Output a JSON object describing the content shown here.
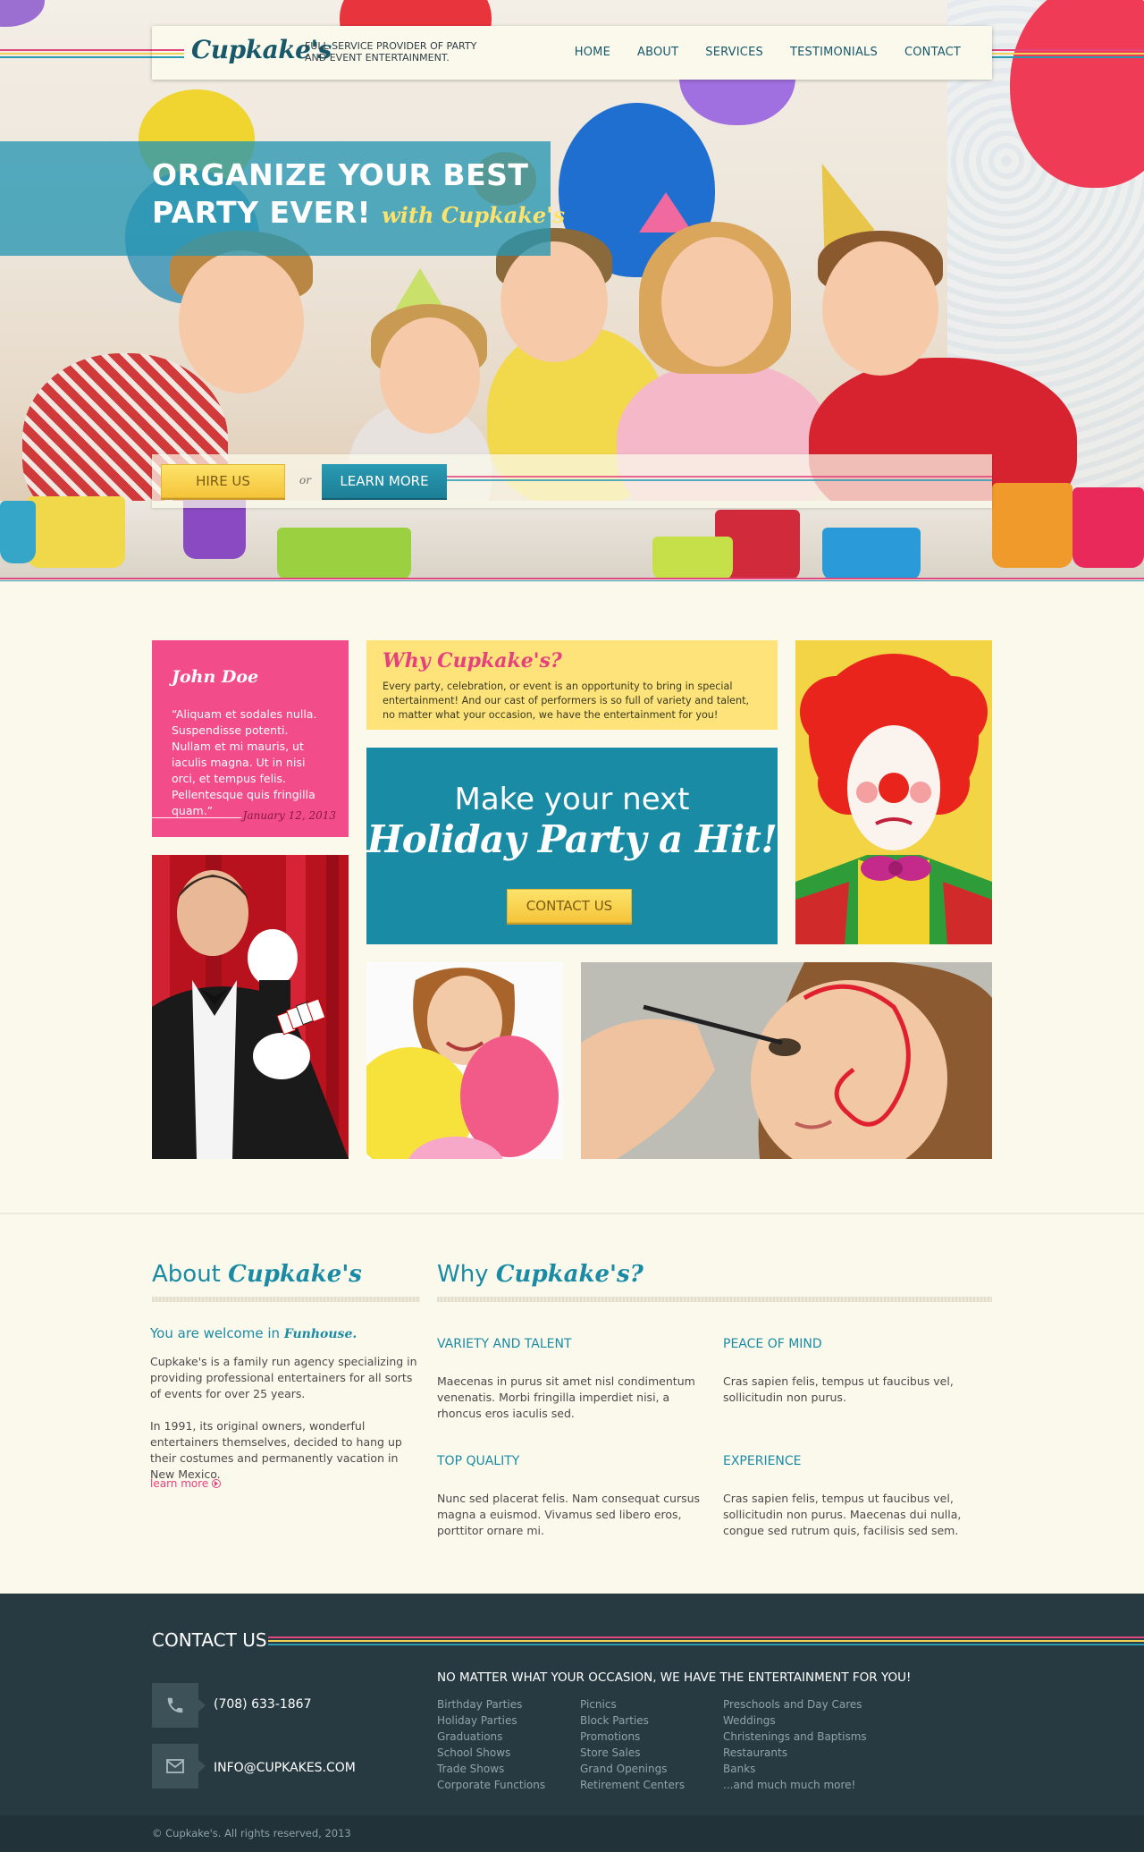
{
  "header": {
    "logo": "Cupkake's",
    "tagline": "FULL SERVICE PROVIDER OF PARTY AND EVENT ENTERTAINMENT.",
    "nav": [
      "HOME",
      "ABOUT",
      "SERVICES",
      "TESTIMONIALS",
      "CONTACT"
    ]
  },
  "hero": {
    "line1": "ORGANIZE YOUR BEST",
    "line2": "PARTY EVER!",
    "with_text": "with Cupkake's",
    "hire_label": "HIRE US",
    "or_label": "or",
    "learn_label": "LEARN MORE"
  },
  "testimonial": {
    "name": "John Doe",
    "quote": "Aliquam et sodales nulla. Suspendisse potenti. Nullam et mi mauris, ut iaculis magna. Ut in nisi orci, et tempus felis. Pellentesque quis fringilla quam.",
    "date": "January 12, 2013"
  },
  "why_box": {
    "title": "Why Cupkake's?",
    "text": "Every party, celebration, or event is an opportunity to bring in special entertainment!  And our cast of performers is so full of variety and talent, no matter what your occasion, we have the entertainment for you!"
  },
  "promo": {
    "line1": "Make your next",
    "line2": "Holiday Party a Hit!",
    "button": "CONTACT US"
  },
  "about": {
    "title_plain": "About",
    "title_script": "Cupkake's",
    "welcome_plain": "You are welcome in",
    "welcome_script": "Funhouse.",
    "para1": "Cupkake's is a family run agency specializing in providing professional entertainers for all sorts of events for over 25 years.",
    "para2": "In 1991, its original owners, wonderful entertainers themselves, decided to hang up their costumes and permanently vacation in New Mexico.",
    "learn_more": "learn more"
  },
  "why": {
    "title_plain": "Why",
    "title_script": "Cupkake's?",
    "features": [
      {
        "title": "VARIETY AND TALENT",
        "text": "Maecenas in purus sit amet nisl condimentum venenatis. Morbi fringilla imperdiet nisi, a rhoncus eros iaculis sed."
      },
      {
        "title": "PEACE OF MIND",
        "text": "Cras sapien felis, tempus ut faucibus vel, sollicitudin non purus."
      },
      {
        "title": "TOP QUALITY",
        "text": "Nunc sed placerat felis. Nam consequat cursus magna a euismod. Vivamus sed libero eros, porttitor ornare mi."
      },
      {
        "title": "EXPERIENCE",
        "text": "Cras sapien felis, tempus ut faucibus vel, sollicitudin non purus. Maecenas dui nulla, congue sed rutrum quis, facilisis sed sem."
      }
    ]
  },
  "footer": {
    "title": "CONTACT US",
    "phone": "(708) 633-1867",
    "email": "INFO@CUPKAKES.COM",
    "headline": "NO MATTER WHAT YOUR OCCASION, WE HAVE THE ENTERTAINMENT FOR YOU!",
    "col1": [
      "Birthday Parties",
      "Holiday Parties",
      "Graduations",
      "School Shows",
      "Trade Shows",
      "Corporate Functions"
    ],
    "col2": [
      "Picnics",
      "Block Parties",
      "Promotions",
      "Store Sales",
      "Grand Openings",
      "Retirement Centers"
    ],
    "col3": [
      "Preschools and Day Cares",
      "Weddings",
      "Christenings and Baptisms",
      "Restaurants",
      "Banks",
      "...and much much more!"
    ],
    "copyright": "© Cupkake's. All rights reserved, 2013"
  },
  "icons": [
    "phone-icon",
    "mail-icon",
    "arrow-circle-icon"
  ],
  "colors": {
    "teal": "#1a8ba5",
    "pink": "#f24c8a",
    "yellow": "#fde37a",
    "footer": "#273a42",
    "background": "#fbf9ec"
  }
}
